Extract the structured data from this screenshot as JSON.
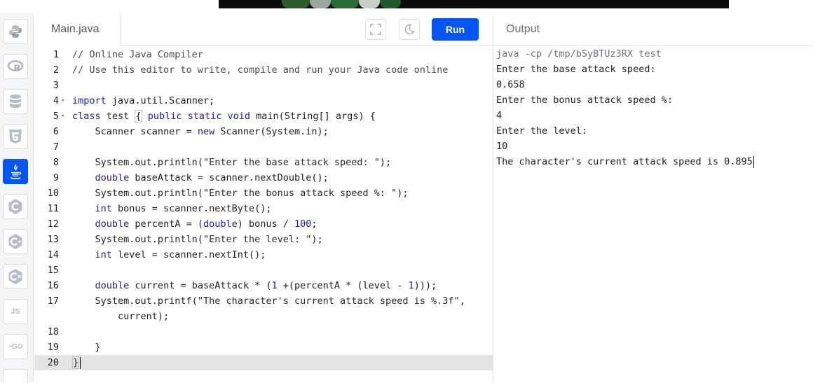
{
  "sidebar": {
    "languages": [
      {
        "name": "python",
        "icon": "python-icon",
        "active": false
      },
      {
        "name": "r",
        "icon": "r-icon",
        "active": false
      },
      {
        "name": "sql",
        "icon": "database-icon",
        "active": false
      },
      {
        "name": "html",
        "icon": "html5-icon",
        "active": false
      },
      {
        "name": "java",
        "icon": "java-icon",
        "active": true
      },
      {
        "name": "c",
        "icon": "c-icon",
        "active": false
      },
      {
        "name": "cpp",
        "icon": "cpp-icon",
        "active": false
      },
      {
        "name": "csharp",
        "icon": "csharp-icon",
        "active": false
      },
      {
        "name": "javascript",
        "icon": "js-icon",
        "label": "JS",
        "active": false
      },
      {
        "name": "go",
        "icon": "go-icon",
        "label": "GO",
        "active": false
      }
    ]
  },
  "editor": {
    "file_name": "Main.java",
    "fullscreen_icon": "fullscreen-icon",
    "theme_icon": "moon-icon",
    "run_label": "Run",
    "current_line": 20,
    "lines": [
      {
        "n": "1",
        "fold": false,
        "tokens": [
          [
            "cm",
            "// Online Java Compiler"
          ]
        ]
      },
      {
        "n": "2",
        "fold": false,
        "tokens": [
          [
            "cm",
            "// Use this editor to write, compile and run your Java code online"
          ]
        ]
      },
      {
        "n": "3",
        "fold": false,
        "tokens": []
      },
      {
        "n": "4",
        "fold": true,
        "tokens": [
          [
            "kw",
            "import"
          ],
          [
            "",
            " java.util.Scanner;"
          ]
        ]
      },
      {
        "n": "5",
        "fold": true,
        "tokens": [
          [
            "kw",
            "class"
          ],
          [
            "",
            " test "
          ],
          [
            "br",
            "{"
          ],
          [
            "",
            " "
          ],
          [
            "kw",
            "public static void"
          ],
          [
            "",
            " main(String[] args) {"
          ]
        ]
      },
      {
        "n": "6",
        "fold": false,
        "tokens": [
          [
            "",
            "    Scanner scanner = "
          ],
          [
            "kw",
            "new"
          ],
          [
            "",
            " Scanner(System.in);"
          ]
        ]
      },
      {
        "n": "7",
        "fold": false,
        "tokens": []
      },
      {
        "n": "8",
        "fold": false,
        "tokens": [
          [
            "",
            "    System.out.println("
          ],
          [
            "str",
            "\"Enter the base attack speed: \""
          ],
          [
            "",
            ");"
          ]
        ]
      },
      {
        "n": "9",
        "fold": false,
        "tokens": [
          [
            "",
            "    "
          ],
          [
            "kw",
            "double"
          ],
          [
            "",
            " baseAttack = scanner.nextDouble();"
          ]
        ]
      },
      {
        "n": "10",
        "fold": false,
        "tokens": [
          [
            "",
            "    System.out.println("
          ],
          [
            "str",
            "\"Enter the bonus attack speed %: \""
          ],
          [
            "",
            ");"
          ]
        ]
      },
      {
        "n": "11",
        "fold": false,
        "tokens": [
          [
            "",
            "    "
          ],
          [
            "kw",
            "int"
          ],
          [
            "",
            " bonus = scanner.nextByte();"
          ]
        ]
      },
      {
        "n": "12",
        "fold": false,
        "tokens": [
          [
            "",
            "    "
          ],
          [
            "kw",
            "double"
          ],
          [
            "",
            " percentA = ("
          ],
          [
            "kw",
            "double"
          ],
          [
            "",
            ") bonus / "
          ],
          [
            "num",
            "100"
          ],
          [
            "",
            ";"
          ]
        ]
      },
      {
        "n": "13",
        "fold": false,
        "tokens": [
          [
            "",
            "    System.out.println("
          ],
          [
            "str",
            "\"Enter the level: \""
          ],
          [
            "",
            ");"
          ]
        ]
      },
      {
        "n": "14",
        "fold": false,
        "tokens": [
          [
            "",
            "    "
          ],
          [
            "kw",
            "int"
          ],
          [
            "",
            " level = scanner.nextInt();"
          ]
        ]
      },
      {
        "n": "15",
        "fold": false,
        "tokens": []
      },
      {
        "n": "16",
        "fold": false,
        "tokens": [
          [
            "",
            "    "
          ],
          [
            "kw",
            "double"
          ],
          [
            "",
            " current = baseAttack * ("
          ],
          [
            "num",
            "1"
          ],
          [
            "",
            " +(percentA * (level - "
          ],
          [
            "num",
            "1"
          ],
          [
            "",
            ")));"
          ]
        ]
      },
      {
        "n": "17",
        "fold": false,
        "tokens": [
          [
            "",
            "    System.out.printf("
          ],
          [
            "str",
            "\"The character's current attack speed is %.3f\""
          ],
          [
            "",
            ","
          ]
        ]
      },
      {
        "n": "",
        "fold": false,
        "tokens": [
          [
            "",
            "        current);"
          ]
        ]
      },
      {
        "n": "18",
        "fold": false,
        "tokens": []
      },
      {
        "n": "19",
        "fold": false,
        "tokens": [
          [
            "",
            "    }"
          ]
        ]
      },
      {
        "n": "20",
        "fold": false,
        "tokens": [
          [
            "br",
            "}"
          ]
        ]
      }
    ]
  },
  "output": {
    "title": "Output",
    "command": "java -cp /tmp/bSyBTUz3RX test",
    "lines": [
      "Enter the base attack speed:",
      "0.658",
      "Enter the bonus attack speed %:",
      "4",
      "Enter the level:",
      "10",
      "The character's current attack speed is 0.895"
    ]
  },
  "colors": {
    "accent": "#0556f3",
    "border": "#e4e6ea",
    "current_line": "#e4e4e4"
  }
}
